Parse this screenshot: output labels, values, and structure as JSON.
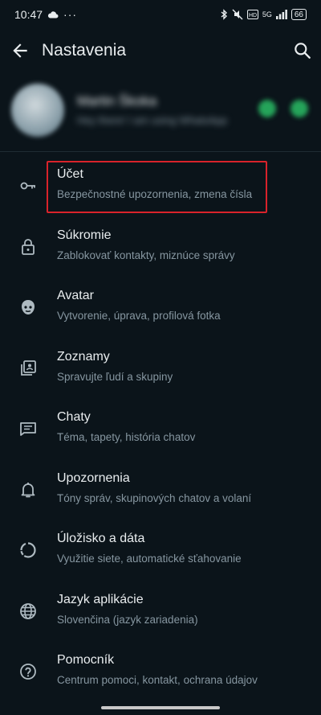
{
  "status_bar": {
    "time": "10:47",
    "network": "5G",
    "battery": "66"
  },
  "app_bar": {
    "title": "Nastavenia"
  },
  "profile": {
    "name": "Martin Škoka",
    "about": "Hey there! I am using WhatsApp"
  },
  "menu": [
    {
      "label": "Účet",
      "sub": "Bezpečnostné upozornenia, zmena čísla",
      "icon": "key-icon"
    },
    {
      "label": "Súkromie",
      "sub": "Zablokovať kontakty, miznúce správy",
      "icon": "lock-icon"
    },
    {
      "label": "Avatar",
      "sub": "Vytvorenie, úprava, profilová fotka",
      "icon": "avatar-icon"
    },
    {
      "label": "Zoznamy",
      "sub": "Spravujte ľudí a skupiny",
      "icon": "lists-icon"
    },
    {
      "label": "Chaty",
      "sub": "Téma, tapety, história chatov",
      "icon": "chat-icon"
    },
    {
      "label": "Upozornenia",
      "sub": "Tóny správ, skupinových chatov a volaní",
      "icon": "bell-icon"
    },
    {
      "label": "Úložisko a dáta",
      "sub": "Využitie siete, automatické sťahovanie",
      "icon": "storage-icon"
    },
    {
      "label": "Jazyk aplikácie",
      "sub": "Slovenčina (jazyk zariadenia)",
      "icon": "globe-icon"
    },
    {
      "label": "Pomocník",
      "sub": "Centrum pomoci, kontakt, ochrana údajov",
      "icon": "help-icon"
    }
  ],
  "colors": {
    "background": "#0b141a",
    "text_primary": "#e9edef",
    "text_secondary": "#8696a0",
    "highlight": "#d9232b",
    "accent": "#25a45a"
  }
}
